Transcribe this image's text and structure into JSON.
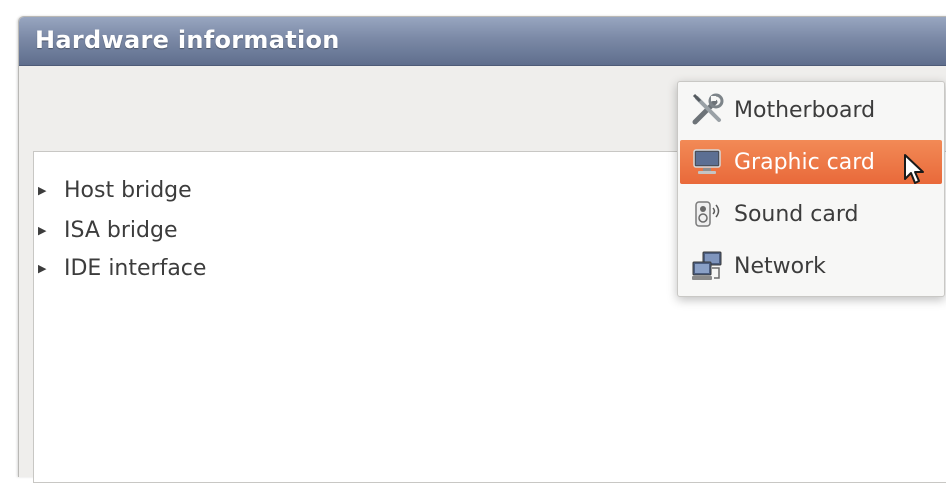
{
  "window": {
    "title": "Hardware information"
  },
  "tree": {
    "items": [
      {
        "label": "Host bridge"
      },
      {
        "label": "ISA bridge"
      },
      {
        "label": "IDE interface"
      }
    ]
  },
  "menu": {
    "items": [
      {
        "label": "Motherboard",
        "icon": "tools-icon",
        "selected": false
      },
      {
        "label": "Graphic card",
        "icon": "monitor-icon",
        "selected": true
      },
      {
        "label": "Sound card",
        "icon": "speaker-icon",
        "selected": false
      },
      {
        "label": "Network",
        "icon": "network-icon",
        "selected": false
      }
    ],
    "highlight_color": "#e9693a"
  }
}
